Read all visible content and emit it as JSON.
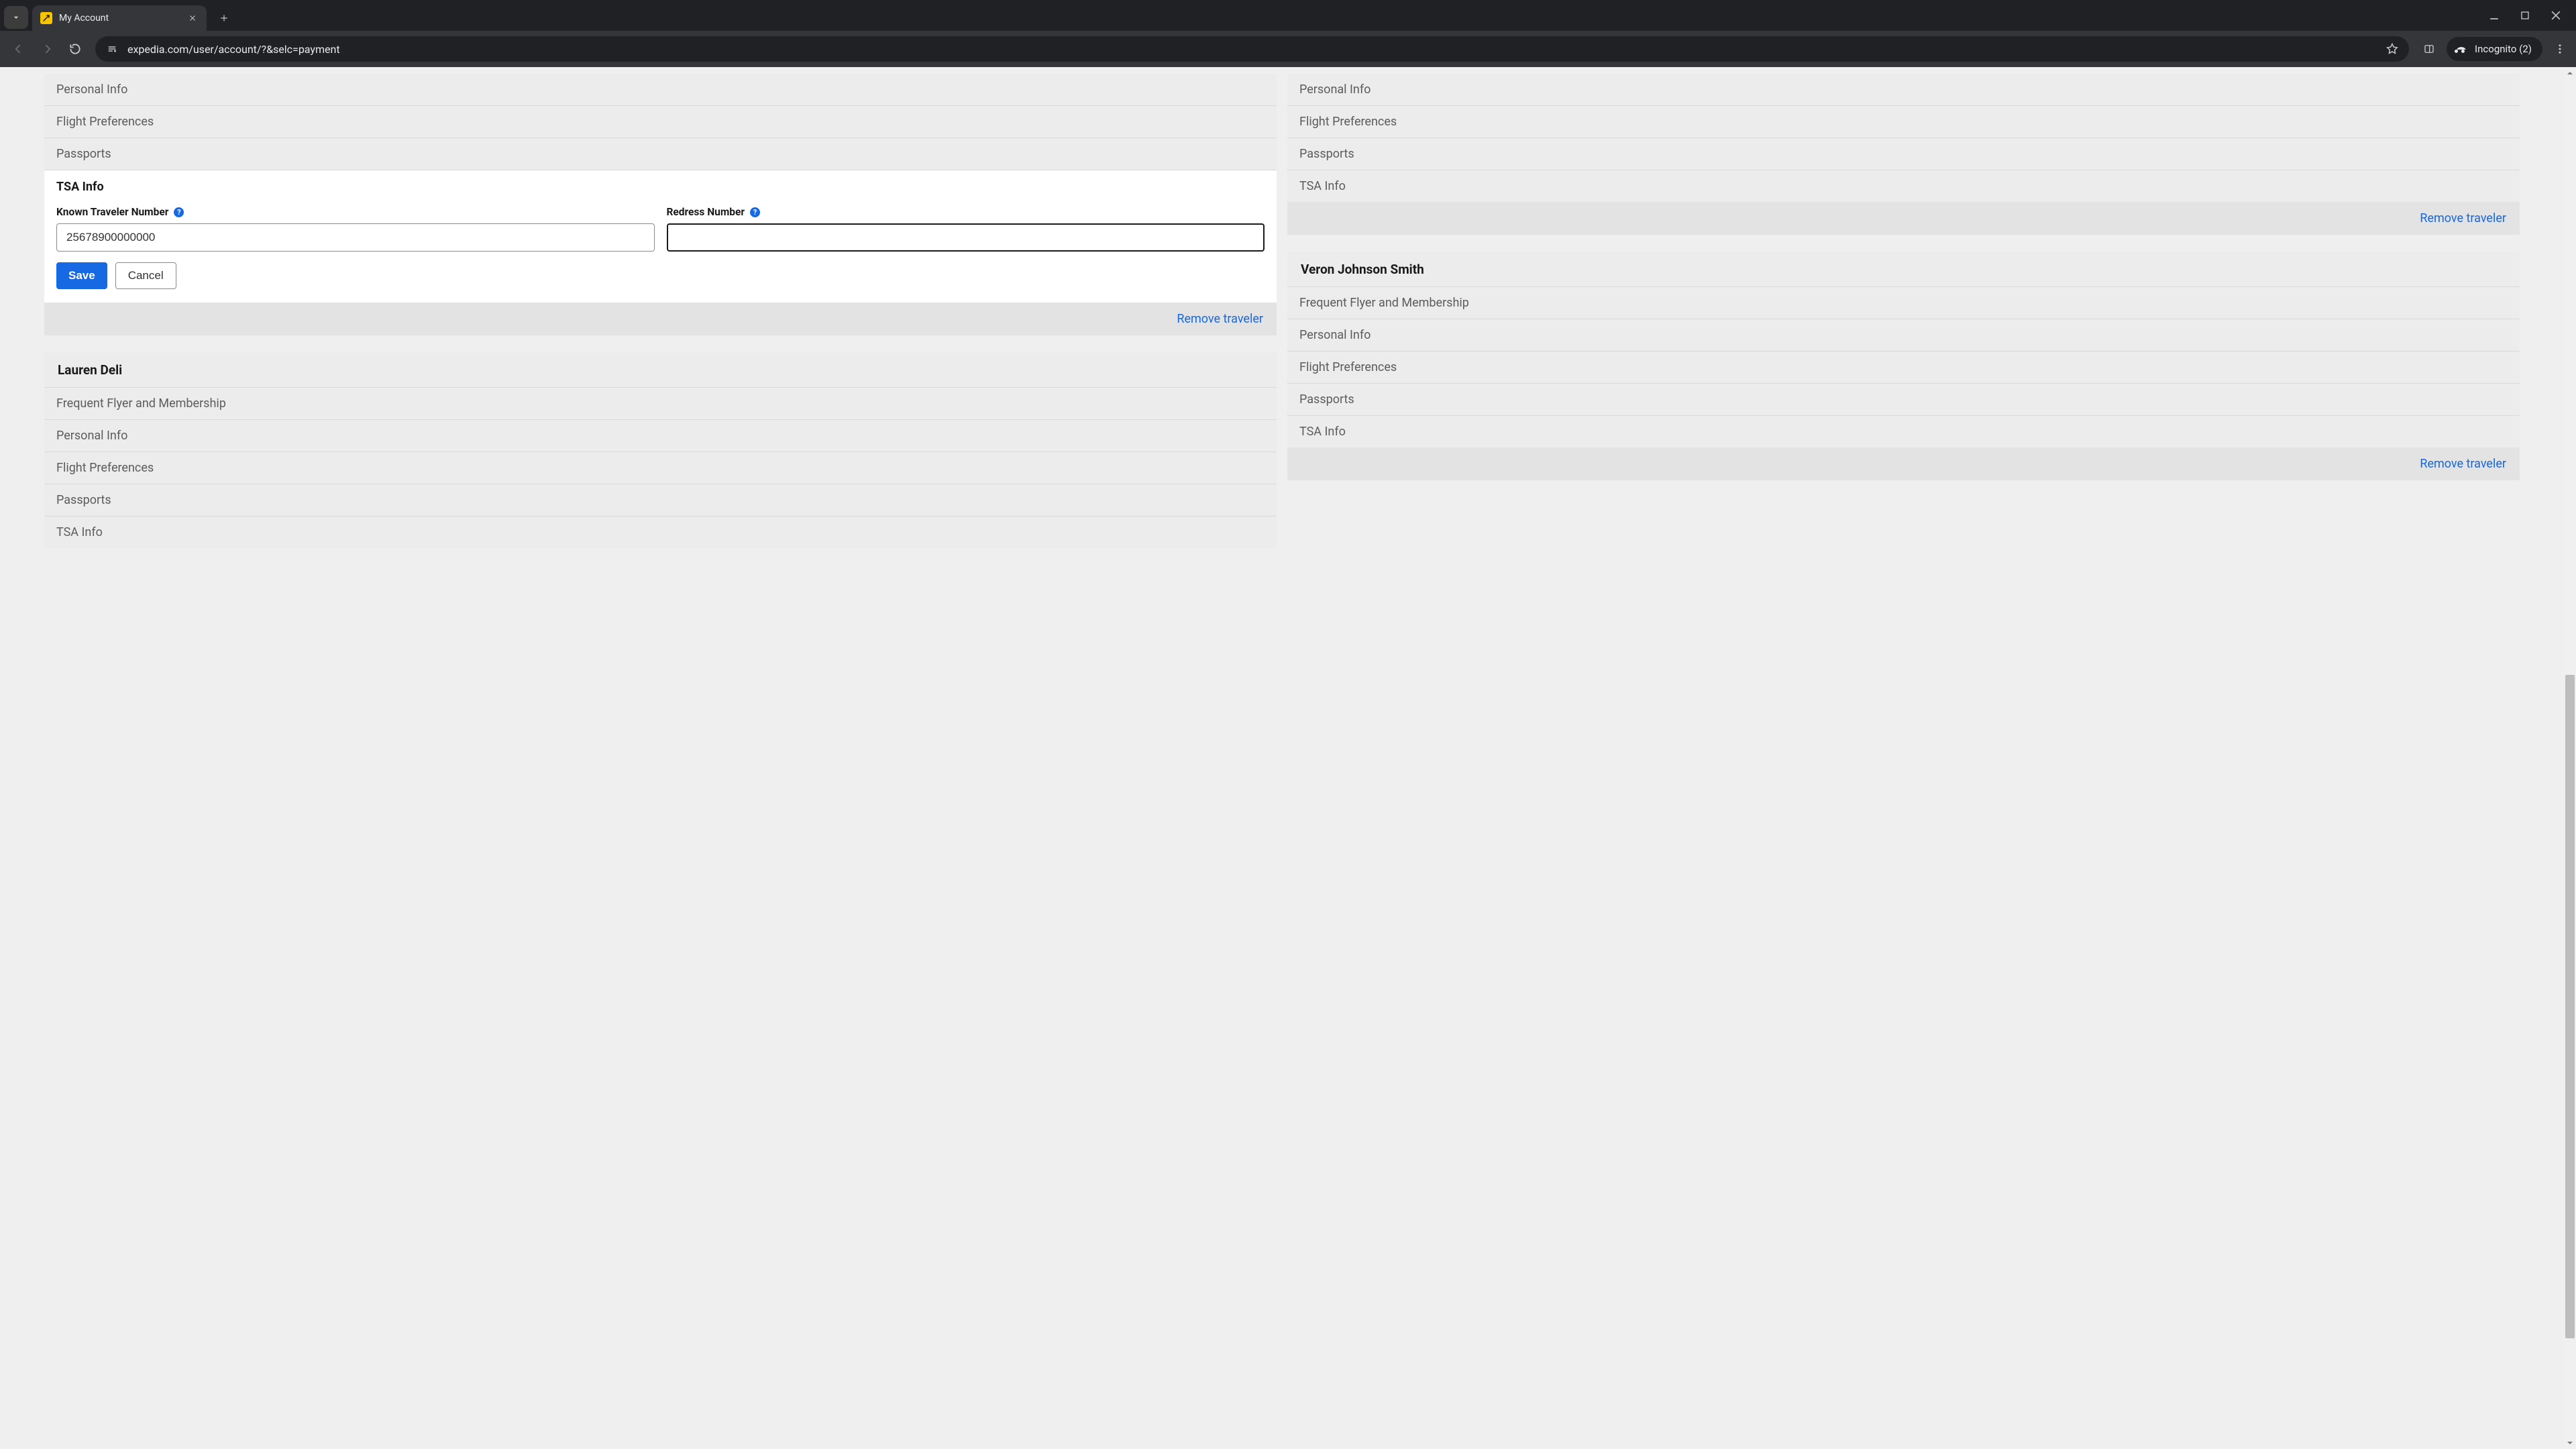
{
  "browser": {
    "tab_title": "My Account",
    "url": "expedia.com/user/account/?&selc=payment",
    "incognito_label": "Incognito (2)"
  },
  "sections": {
    "personal_info": "Personal Info",
    "flight_preferences": "Flight Preferences",
    "passports": "Passports",
    "tsa_info": "TSA Info",
    "frequent_flyer": "Frequent Flyer and Membership"
  },
  "tsa_form": {
    "heading": "TSA Info",
    "ktn_label": "Known Traveler Number",
    "ktn_value": "25678900000000",
    "redress_label": "Redress Number",
    "redress_value": "",
    "save": "Save",
    "cancel": "Cancel",
    "help_glyph": "?"
  },
  "travelers": {
    "lauren": "Lauren Deli",
    "veron": "Veron Johnson Smith"
  },
  "actions": {
    "remove_traveler": "Remove traveler"
  }
}
